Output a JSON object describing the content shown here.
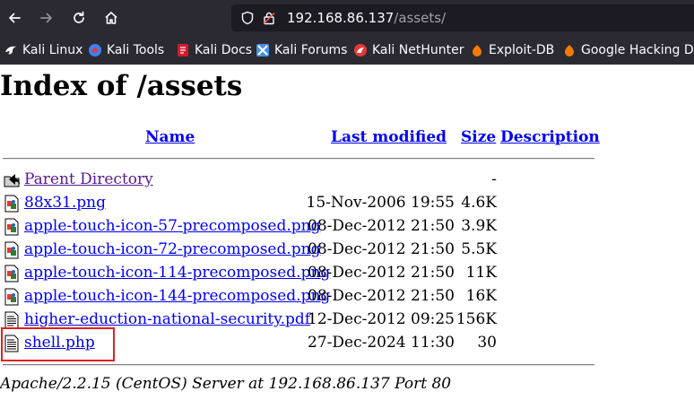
{
  "browser": {
    "url_host": "192.168.86.137",
    "url_path": "/assets/",
    "bookmarks": [
      {
        "label": "Kali Linux",
        "icon": "kali-dragon-icon",
        "color": "#1e90ff"
      },
      {
        "label": "Kali Tools",
        "icon": "kali-tools-icon",
        "color": "#3b82f6"
      },
      {
        "label": "Kali Docs",
        "icon": "kali-docs-icon",
        "color": "#d11a2a"
      },
      {
        "label": "Kali Forums",
        "icon": "kali-forums-icon",
        "color": "#4a90e2"
      },
      {
        "label": "Kali NetHunter",
        "icon": "nethunter-icon",
        "color": "#e53935"
      },
      {
        "label": "Exploit-DB",
        "icon": "exploit-db-icon",
        "color": "#f57c00"
      },
      {
        "label": "Google Hacking DB",
        "icon": "ghdb-icon",
        "color": "#f57c00"
      }
    ]
  },
  "page": {
    "title": "Index of /assets",
    "columns": {
      "name": "Name",
      "last_modified": "Last modified",
      "size": "Size",
      "description": "Description"
    },
    "entries": [
      {
        "name": "Parent Directory",
        "modified": "",
        "size": "-",
        "icon": "back-folder-icon",
        "visited": true
      },
      {
        "name": "88x31.png",
        "modified": "15-Nov-2006 19:55",
        "size": "4.6K",
        "icon": "image-file-icon"
      },
      {
        "name": "apple-touch-icon-57-precomposed.png",
        "modified": "08-Dec-2012 21:50",
        "size": "3.9K",
        "icon": "image-file-icon"
      },
      {
        "name": "apple-touch-icon-72-precomposed.png",
        "modified": "08-Dec-2012 21:50",
        "size": "5.5K",
        "icon": "image-file-icon"
      },
      {
        "name": "apple-touch-icon-114-precomposed.png",
        "modified": "08-Dec-2012 21:50",
        "size": "11K",
        "icon": "image-file-icon"
      },
      {
        "name": "apple-touch-icon-144-precomposed.png",
        "modified": "08-Dec-2012 21:50",
        "size": "16K",
        "icon": "image-file-icon"
      },
      {
        "name": "higher-eduction-national-security.pdf",
        "modified": "12-Dec-2012 09:25",
        "size": "156K",
        "icon": "document-file-icon"
      },
      {
        "name": "shell.php",
        "modified": "27-Dec-2024 11:30",
        "size": "30",
        "icon": "text-file-icon",
        "highlighted": true
      }
    ],
    "footer": "Apache/2.2.15 (CentOS) Server at 192.168.86.137 Port 80",
    "highlight_color": "#e02020"
  }
}
